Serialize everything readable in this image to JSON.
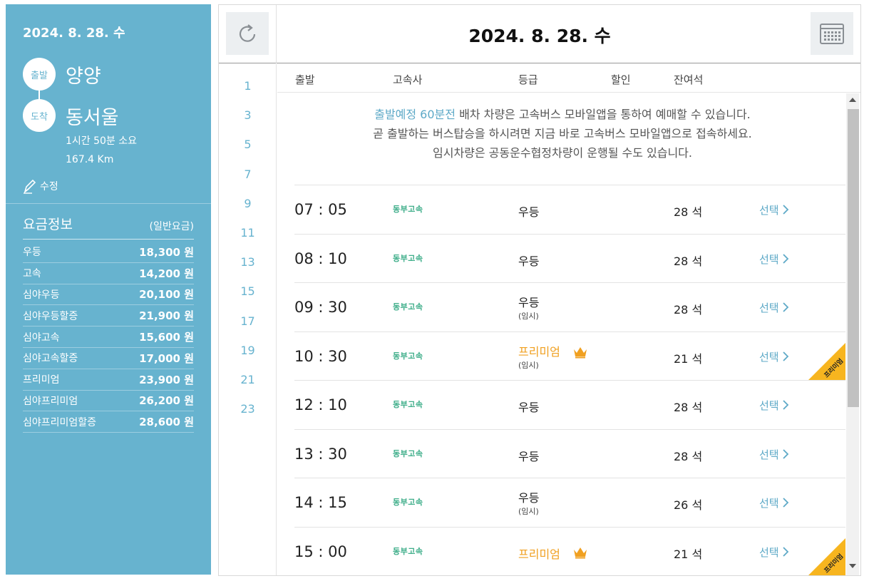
{
  "sidebar": {
    "date": "2024. 8. 28. 수",
    "departure_badge": "출발",
    "departure": "양양",
    "arrival_badge": "도착",
    "arrival": "동서울",
    "duration": "1시간 50분 소요",
    "distance": "167.4 Km",
    "edit_label": "수정",
    "fare_title": "요금정보",
    "fare_note": "(일반요금)",
    "fares": [
      {
        "grade": "우등",
        "price": "18,300 원"
      },
      {
        "grade": "고속",
        "price": "14,200 원"
      },
      {
        "grade": "심야우등",
        "price": "20,100 원"
      },
      {
        "grade": "심야우등할증",
        "price": "21,900 원"
      },
      {
        "grade": "심야고속",
        "price": "15,600 원"
      },
      {
        "grade": "심야고속할증",
        "price": "17,000 원"
      },
      {
        "grade": "프리미엄",
        "price": "23,900 원"
      },
      {
        "grade": "심야프리미엄",
        "price": "26,200 원"
      },
      {
        "grade": "심야프리미엄할증",
        "price": "28,600 원"
      }
    ]
  },
  "main": {
    "date": "2024. 8. 28. 수",
    "hours": [
      "1",
      "3",
      "5",
      "7",
      "9",
      "11",
      "13",
      "15",
      "17",
      "19",
      "21",
      "23"
    ],
    "columns": {
      "departure": "출발",
      "company": "고속사",
      "grade": "등급",
      "discount": "할인",
      "seats": "잔여석"
    },
    "notice": {
      "line1_highlight": "출발예정 60분전",
      "line1_rest": " 배차 차량은 고속버스 모바일앱을 통하여 예매할 수 있습니다.",
      "line2": "곧 출발하는 버스탑승을 하시려면 지금 바로 고속버스 모바일앱으로 접속하세요.",
      "line3": "임시차량은 공동운수협정차량이 운행될 수도 있습니다."
    },
    "schedules": [
      {
        "time": "07 : 05",
        "company": "동부고속",
        "grade": "우등",
        "temp": "",
        "premium": false,
        "seats": "28 석",
        "select": "선택"
      },
      {
        "time": "08 : 10",
        "company": "동부고속",
        "grade": "우등",
        "temp": "",
        "premium": false,
        "seats": "28 석",
        "select": "선택"
      },
      {
        "time": "09 : 30",
        "company": "동부고속",
        "grade": "우등",
        "temp": "(임시)",
        "premium": false,
        "seats": "28 석",
        "select": "선택"
      },
      {
        "time": "10 : 30",
        "company": "동부고속",
        "grade": "프리미엄",
        "temp": "(임시)",
        "premium": true,
        "seats": "21 석",
        "select": "선택"
      },
      {
        "time": "12 : 10",
        "company": "동부고속",
        "grade": "우등",
        "temp": "",
        "premium": false,
        "seats": "28 석",
        "select": "선택"
      },
      {
        "time": "13 : 30",
        "company": "동부고속",
        "grade": "우등",
        "temp": "",
        "premium": false,
        "seats": "28 석",
        "select": "선택"
      },
      {
        "time": "14 : 15",
        "company": "동부고속",
        "grade": "우등",
        "temp": "(임시)",
        "premium": false,
        "seats": "26 석",
        "select": "선택"
      },
      {
        "time": "15 : 00",
        "company": "동부고속",
        "grade": "프리미엄",
        "temp": "",
        "premium": true,
        "seats": "21 석",
        "select": "선택"
      }
    ],
    "premium_ribbon": "프리미엄"
  },
  "colors": {
    "sidebar_bg": "#67b3cf",
    "accent": "#5da9c7",
    "premium": "#f0a020",
    "company": "#3fae8a",
    "ribbon": "#f7b51f"
  },
  "icons": [
    "refresh-icon",
    "calendar-icon",
    "pencil-icon",
    "crown-icon",
    "chevron-right-icon"
  ]
}
